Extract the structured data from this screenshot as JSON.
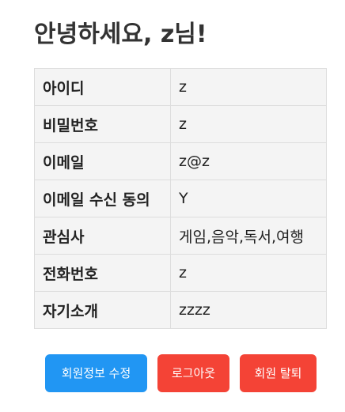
{
  "header": {
    "title": "안녕하세요, z님!"
  },
  "profile_table": {
    "rows": [
      {
        "label": "아이디",
        "value": "z"
      },
      {
        "label": "비밀번호",
        "value": "z"
      },
      {
        "label": "이메일",
        "value": "z@z"
      },
      {
        "label": "이메일 수신 동의",
        "value": "Y"
      },
      {
        "label": "관심사",
        "value": "게임,음악,독서,여행"
      },
      {
        "label": "전화번호",
        "value": "z"
      },
      {
        "label": "자기소개",
        "value": "zzzz"
      }
    ]
  },
  "actions": {
    "edit_label": "회원정보 수정",
    "logout_label": "로그아웃",
    "withdraw_label": "회원 탈퇴"
  },
  "colors": {
    "primary": "#2196f3",
    "danger": "#f44336",
    "table_bg": "#f4f4f4",
    "border": "#dddddd"
  }
}
